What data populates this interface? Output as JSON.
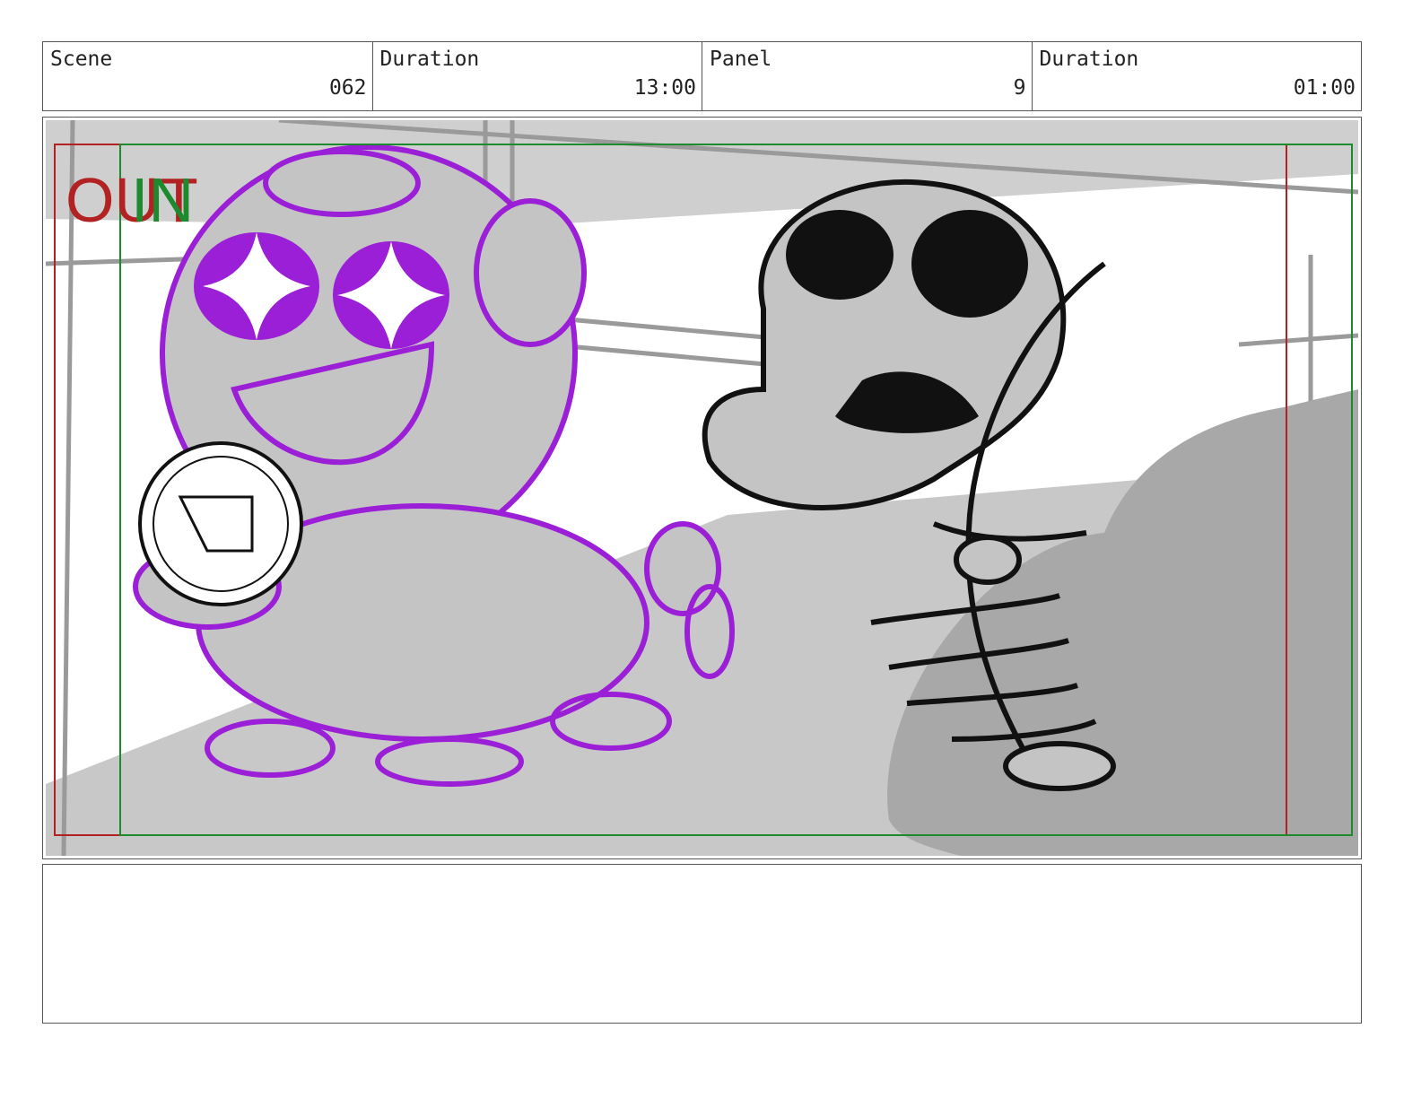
{
  "header": {
    "scene": {
      "label": "Scene",
      "value": "062"
    },
    "duration": {
      "label": "Duration",
      "value": "13:00"
    },
    "panel": {
      "label": "Panel",
      "value": "9"
    },
    "panel_duration": {
      "label": "Duration",
      "value": "01:00"
    }
  },
  "frame": {
    "out_label": "OUT",
    "in_label": "IN",
    "out_color": "#b22222",
    "in_color": "#1e8a2e"
  },
  "art": {
    "character_left_color": "#9b1fd6",
    "character_right_color": "#111111",
    "background_color": "#c8c8c8"
  },
  "notes": {
    "text": ""
  }
}
